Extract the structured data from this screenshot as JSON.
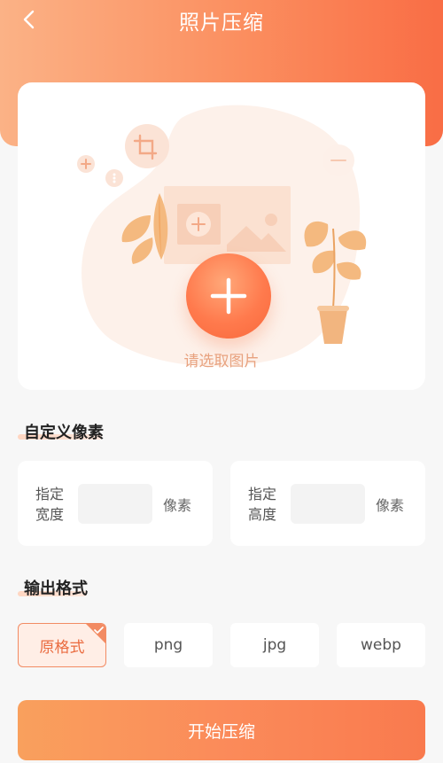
{
  "header": {
    "title": "照片压缩",
    "colors": {
      "gradient_start": "#fbb286",
      "gradient_end": "#f96d45"
    }
  },
  "upload": {
    "label": "请选取图片",
    "icon": "plus-icon"
  },
  "custom_pixels": {
    "section_title": "自定义像素",
    "width": {
      "label": "指定宽度",
      "value": "",
      "unit": "像素"
    },
    "height": {
      "label": "指定高度",
      "value": "",
      "unit": "像素"
    }
  },
  "output_format": {
    "section_title": "输出格式",
    "options": [
      "原格式",
      "png",
      "jpg",
      "webp"
    ],
    "selected": "原格式"
  },
  "start_button": {
    "label": "开始压缩"
  },
  "accent_color": "#f97a4e"
}
